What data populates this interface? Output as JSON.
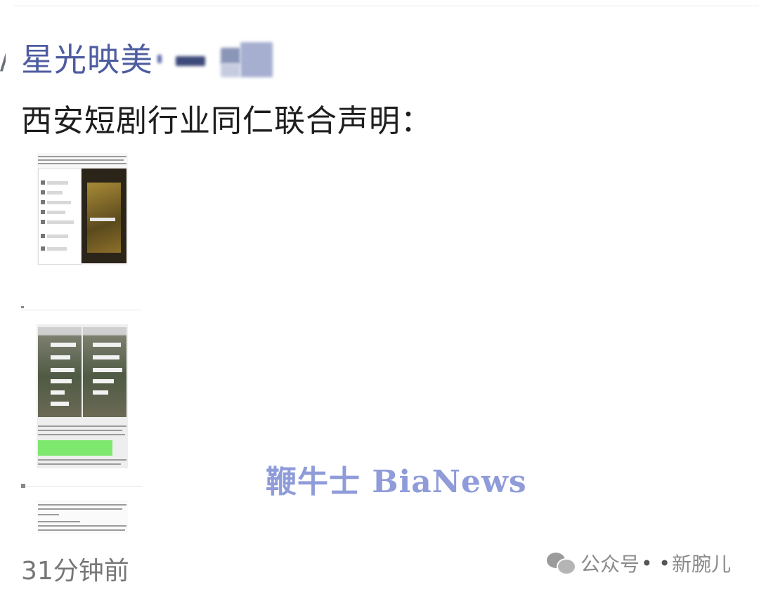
{
  "post": {
    "author": "星光映美",
    "text": "西安短剧行业同仁联合声明：",
    "timestamp": "31分钟前"
  },
  "images": [
    {
      "kind": "screenshot-document-with-chats"
    },
    {
      "kind": "screenshot-chat-with-highlighted-text"
    },
    {
      "kind": "screenshot-document-text"
    }
  ],
  "watermarks": {
    "bianews": "鞭牛士 BiaNews",
    "wechat_prefix": "公众号",
    "wechat_account": "新腕儿"
  },
  "colors": {
    "author": "#4e5ca0",
    "text": "#1e1e1e",
    "timestamp": "#777777",
    "watermark": "#8a97d8"
  }
}
